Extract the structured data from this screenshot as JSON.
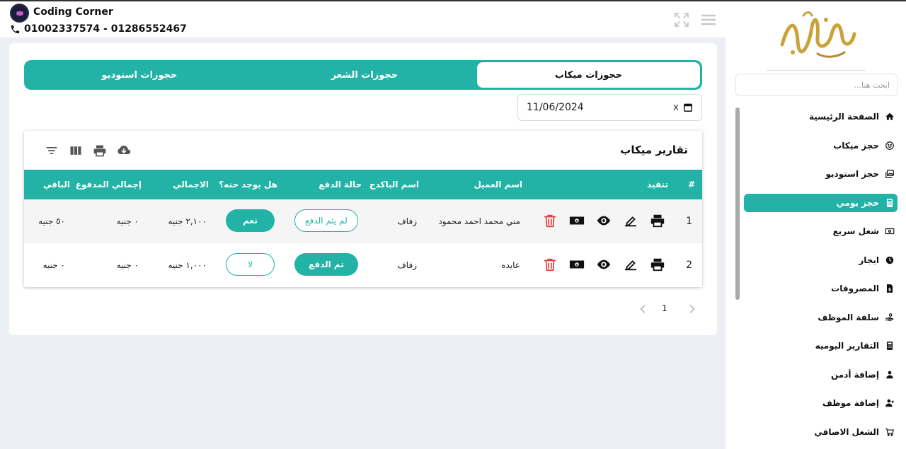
{
  "header": {
    "brand_name": "Coding Corner",
    "phone": "01002337574  - 01286552467"
  },
  "sidebar": {
    "search_placeholder": "ابحث هنا...",
    "items": [
      {
        "label": "الصفحة الرئيسية",
        "icon": "home-icon"
      },
      {
        "label": "حجز ميكاب",
        "icon": "smile-icon"
      },
      {
        "label": "حجز استوديو",
        "icon": "images-icon"
      },
      {
        "label": "حجز يومي",
        "icon": "calculator-icon",
        "active": true
      },
      {
        "label": "شغل سريع",
        "icon": "money-icon"
      },
      {
        "label": "ايجار",
        "icon": "clock-icon"
      },
      {
        "label": "المصروفات",
        "icon": "invoice-icon"
      },
      {
        "label": "سلفة الموظف",
        "icon": "hand-coin-icon"
      },
      {
        "label": "التقارير اليوميه",
        "icon": "report-icon"
      },
      {
        "label": "إضافة أدمن",
        "icon": "admin-icon"
      },
      {
        "label": "إضافة موظف",
        "icon": "user-plus-icon"
      },
      {
        "label": "الشغل الاضافي",
        "icon": "cart-icon"
      }
    ]
  },
  "tabs": [
    {
      "label": "حجوزات ميكاب",
      "active": true
    },
    {
      "label": "حجوزات الشعر"
    },
    {
      "label": "حجوزات استوديو"
    }
  ],
  "date_filter": {
    "value": "11/06/2024",
    "clear": "x"
  },
  "report": {
    "title": "تقارير ميكاب",
    "columns": [
      "#",
      "تنفيذ",
      "اسم العميل",
      "اسم الباكدج",
      "حالة الدفع",
      "هل يوجد حنه؟",
      "الاجمالي",
      "إجمالي المدفوع",
      "الباقي"
    ],
    "rows": [
      {
        "num": "1",
        "client": "مني محمد احمد محمود",
        "package": "زفاف",
        "payment_status": "لم يتم الدفع",
        "payment_paid": false,
        "henna": "نعم",
        "henna_yes": true,
        "total": "٢,١٠٠ جنيه",
        "paid": "٠ جنيه",
        "remaining": "٥٠ جنيه"
      },
      {
        "num": "2",
        "client": "عايده",
        "package": "زفاف",
        "payment_status": "تم الدفع",
        "payment_paid": true,
        "henna": "لا",
        "henna_yes": false,
        "total": "١,٠٠٠ جنيه",
        "paid": "٠ جنيه",
        "remaining": "٠ جنيه"
      }
    ]
  },
  "pagination": {
    "current": "1"
  },
  "colors": {
    "accent": "#22b3a6",
    "delete": "#e53935",
    "logo_gold": "#c9a23a"
  }
}
